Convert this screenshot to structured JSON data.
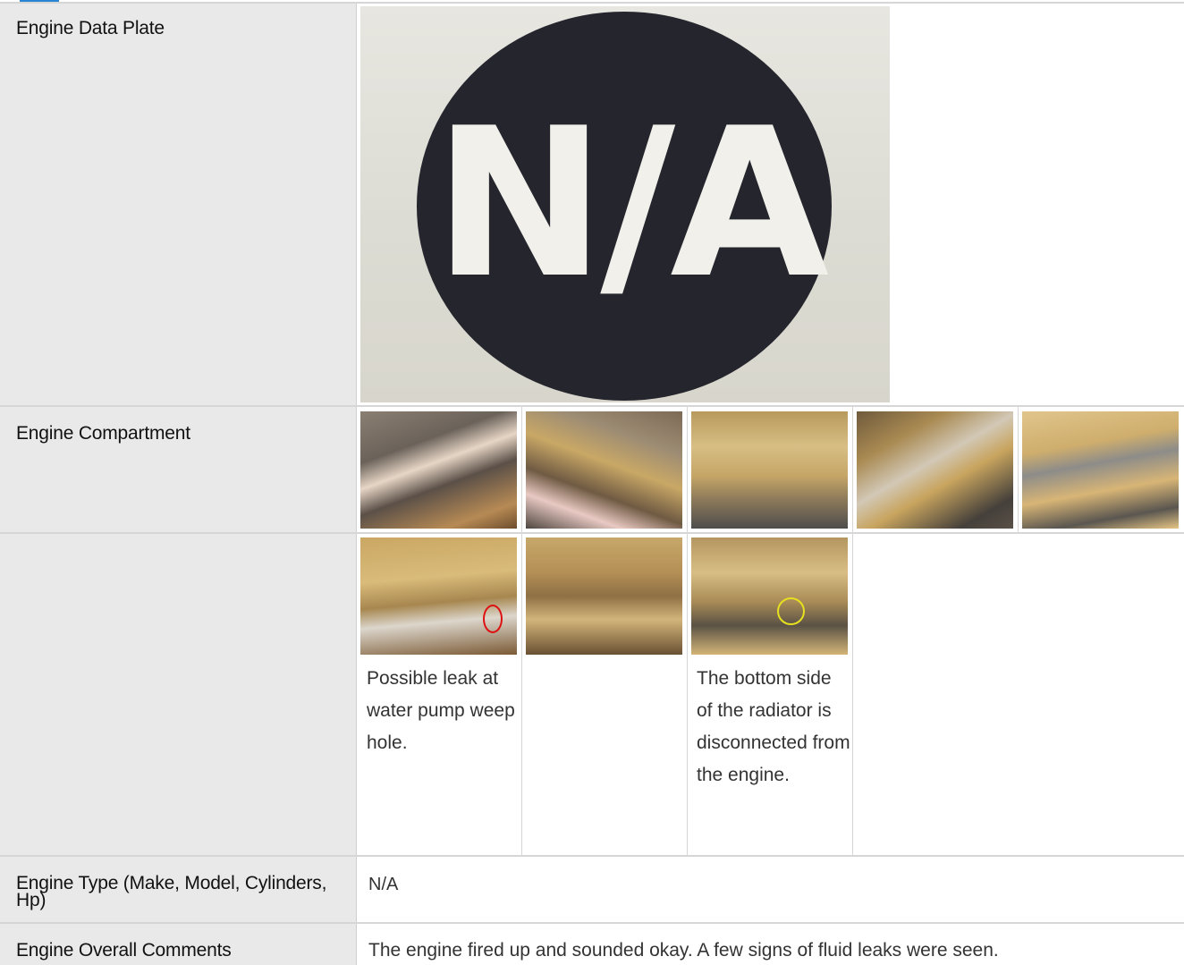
{
  "rows": {
    "data_plate": {
      "label": "Engine Data Plate",
      "image_text": "N/A"
    },
    "compartment": {
      "label": "Engine Compartment"
    },
    "compartment_extra": {
      "captions": [
        "Possible leak at water pump weep hole.",
        "",
        "The bottom side of the radiator is disconnected from the engine."
      ]
    },
    "engine_type": {
      "label": "Engine Type (Make, Model, Cylinders, Hp)",
      "value": "N/A"
    },
    "overall": {
      "label": "Engine Overall Comments",
      "value": "The engine fired up and sounded okay. A few signs of fluid leaks were seen."
    }
  },
  "icons": {
    "leak_marker": "red-circle-marker",
    "radiator_marker": "yellow-circle-marker"
  },
  "colors": {
    "label_bg": "#e9e9e9",
    "accent": "#2a86d4",
    "na_circle": "#25252d"
  }
}
